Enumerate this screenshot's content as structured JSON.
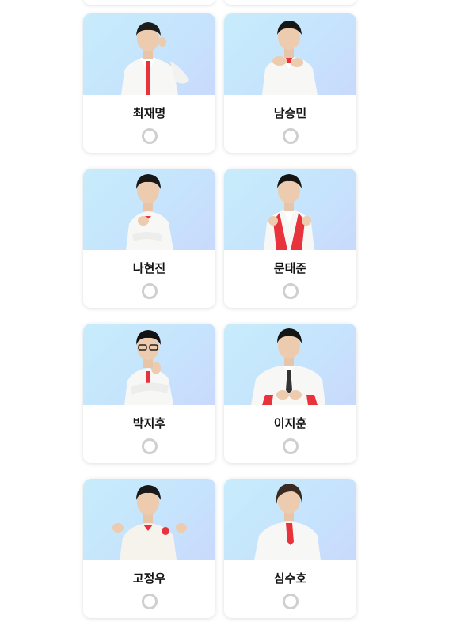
{
  "candidates": [
    {
      "name": "최재명"
    },
    {
      "name": "남승민"
    },
    {
      "name": "나현진"
    },
    {
      "name": "문태준"
    },
    {
      "name": "박지후"
    },
    {
      "name": "이지훈"
    },
    {
      "name": "고정우"
    },
    {
      "name": "심수호"
    }
  ],
  "colors": {
    "photo_bg_start": "#c7ecfb",
    "photo_bg_end": "#c9d9fc",
    "radio_border": "#cfcfcf",
    "accent_red": "#e8333c"
  },
  "icons": {
    "radio": "radio-unchecked-icon"
  }
}
